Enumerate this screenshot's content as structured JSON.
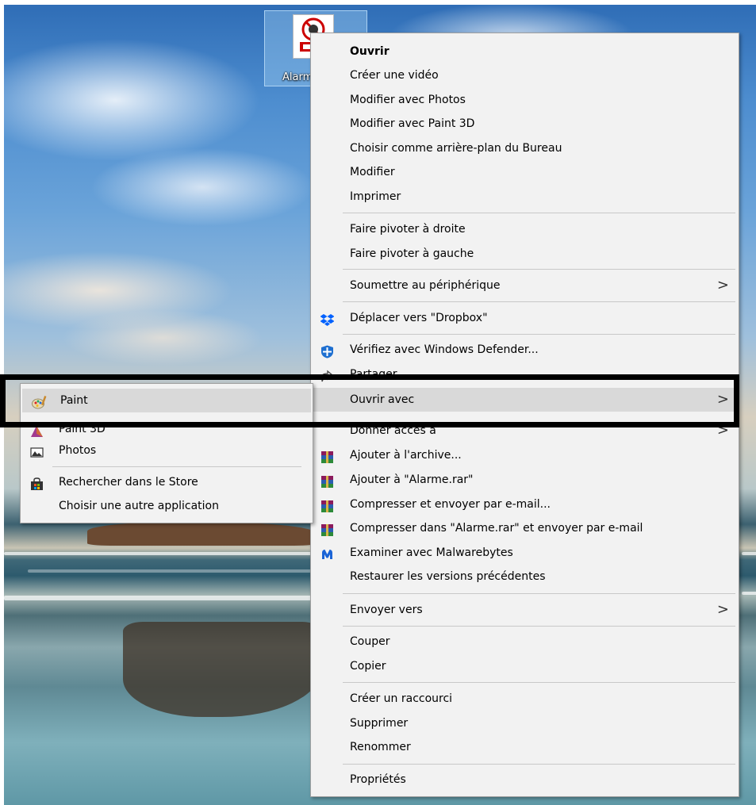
{
  "desktop": {
    "icon_label": "Alarm"
  },
  "context_menu": {
    "items": [
      {
        "id": "ouvrir",
        "label": "Ouvrir"
      },
      {
        "id": "creer-video",
        "label": "Créer une vidéo"
      },
      {
        "id": "modifier-photos",
        "label": "Modifier avec Photos"
      },
      {
        "id": "modifier-paint3d",
        "label": "Modifier avec Paint 3D"
      },
      {
        "id": "arriere-plan",
        "label": "Choisir comme arrière-plan du Bureau"
      },
      {
        "id": "modifier",
        "label": "Modifier"
      },
      {
        "id": "imprimer",
        "label": "Imprimer"
      },
      {
        "id": "pivoter-droite",
        "label": "Faire pivoter à droite"
      },
      {
        "id": "pivoter-gauche",
        "label": "Faire pivoter à gauche"
      },
      {
        "id": "soumettre",
        "label": "Soumettre au périphérique"
      },
      {
        "id": "dropbox",
        "label": "Déplacer vers \"Dropbox\""
      },
      {
        "id": "defender",
        "label": "Vérifiez avec Windows Defender..."
      },
      {
        "id": "partager",
        "label": "Partager"
      },
      {
        "id": "ouvrir-avec",
        "label": "Ouvrir avec"
      },
      {
        "id": "donner-acces",
        "label": "Donner accès à"
      },
      {
        "id": "ajouter-archive",
        "label": "Ajouter à l'archive..."
      },
      {
        "id": "ajouter-rar",
        "label": "Ajouter à \"Alarme.rar\""
      },
      {
        "id": "compresser-email",
        "label": "Compresser et envoyer par e-mail..."
      },
      {
        "id": "compresser-rar-email",
        "label": "Compresser dans \"Alarme.rar\" et envoyer par e-mail"
      },
      {
        "id": "malwarebytes",
        "label": "Examiner avec Malwarebytes"
      },
      {
        "id": "restaurer",
        "label": "Restaurer les versions précédentes"
      },
      {
        "id": "envoyer-vers",
        "label": "Envoyer vers"
      },
      {
        "id": "couper",
        "label": "Couper"
      },
      {
        "id": "copier",
        "label": "Copier"
      },
      {
        "id": "raccourci",
        "label": "Créer un raccourci"
      },
      {
        "id": "supprimer",
        "label": "Supprimer"
      },
      {
        "id": "renommer",
        "label": "Renommer"
      },
      {
        "id": "proprietes",
        "label": "Propriétés"
      }
    ],
    "submenu_arrow": ">"
  },
  "open_with_submenu": {
    "items": [
      {
        "id": "paint",
        "label": "Paint"
      },
      {
        "id": "paint3d",
        "label": "Paint 3D"
      },
      {
        "id": "photos",
        "label": "Photos"
      },
      {
        "id": "store",
        "label": "Rechercher dans le Store"
      },
      {
        "id": "autre-app",
        "label": "Choisir une autre application"
      }
    ]
  },
  "colors": {
    "menu_bg": "#f2f2f2",
    "hover_bg": "#d9d9d9",
    "highlight_box": "#000000",
    "dropbox_blue": "#0061fe",
    "defender_blue": "#1e6fd0",
    "malwarebytes_blue": "#1b64d6"
  }
}
